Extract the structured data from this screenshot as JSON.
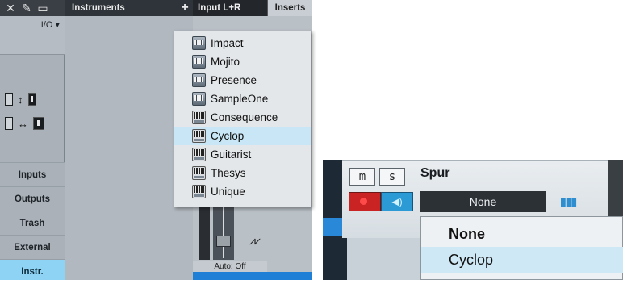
{
  "left_panel": {
    "top_icons": [
      "close-icon",
      "pin-icon",
      "window-icon"
    ],
    "top_glyphs": [
      "✕",
      "✎",
      "▭"
    ],
    "io_label": "I/O",
    "io_chevron": "▾",
    "resize_vertical_glyph": "↕",
    "resize_horizontal_glyph": "↔",
    "sidebar_tabs": [
      "Inputs",
      "Outputs",
      "Trash",
      "External",
      "Instr."
    ],
    "active_tab": "Instr.",
    "instruments_header": "Instruments",
    "add_glyph": "+"
  },
  "mixer": {
    "input_tab": "Input L+R",
    "inserts_tab": "Inserts",
    "automation_label": "Auto: Off",
    "wave_glyph": "⩘⩗"
  },
  "instrument_menu": {
    "items": [
      {
        "label": "Impact",
        "icon": "sampler-icon",
        "highlighted": false
      },
      {
        "label": "Mojito",
        "icon": "sampler-icon",
        "highlighted": false
      },
      {
        "label": "Presence",
        "icon": "sampler-icon",
        "highlighted": false
      },
      {
        "label": "SampleOne",
        "icon": "sampler-icon",
        "highlighted": false
      },
      {
        "label": "Consequence",
        "icon": "synth-icon",
        "highlighted": false
      },
      {
        "label": "Cyclop",
        "icon": "synth-icon",
        "highlighted": true
      },
      {
        "label": "Guitarist",
        "icon": "synth-icon",
        "highlighted": false
      },
      {
        "label": "Thesys",
        "icon": "synth-icon",
        "highlighted": false
      },
      {
        "label": "Unique",
        "icon": "synth-icon",
        "highlighted": false
      }
    ]
  },
  "track": {
    "mute_label": "m",
    "solo_label": "s",
    "name": "Spur",
    "instrument_selected": "None",
    "keyboard_glyph": "▮▮▮",
    "monitor_glyph": "◀)",
    "dropdown_items": [
      "None",
      "Cyclop"
    ],
    "dropdown_bold_item": "None",
    "dropdown_highlight_item": "Cyclop"
  },
  "colors": {
    "active_tab": "#8fd3f4",
    "record": "#c92323",
    "monitor": "#2c9ad4",
    "menu_highlight": "#c8e6f5",
    "automation_bar": "#1f7fd6"
  }
}
